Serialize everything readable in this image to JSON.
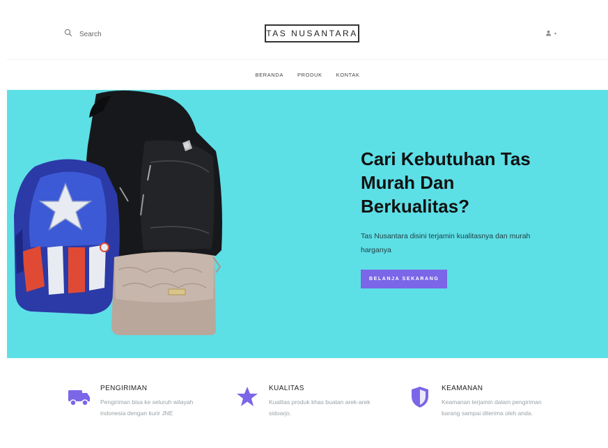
{
  "header": {
    "search": {
      "placeholder": "Search"
    },
    "brand": "TAS NUSANTARA",
    "user_menu": {
      "icon": "user-icon"
    }
  },
  "nav": {
    "items": [
      {
        "label": "BERANDA"
      },
      {
        "label": "PRODUK"
      },
      {
        "label": "KONTAK"
      }
    ]
  },
  "hero": {
    "bg_color": "#5ddfe6",
    "title_line1": "Cari Kebutuhan Tas",
    "title_line2": "Murah Dan",
    "title_line3": "Berkualitas?",
    "subtitle": "Tas Nusantara disini terjamin kualitasnya dan murah harganya",
    "cta_label": "BELANJA SEKARANG",
    "cta_color": "#7b66e8"
  },
  "features": [
    {
      "icon": "truck-icon",
      "title": "PENGIRIMAN",
      "text": "Pengiriman bisa ke seluruh wilayah indonesia dengan kurir JNE"
    },
    {
      "icon": "star-icon",
      "title": "KUALITAS",
      "text": "Kualitas produk khas buatan arek-arek sidoarjo."
    },
    {
      "icon": "shield-icon",
      "title": "KEAMANAN",
      "text": "Keamanan terjamin dalam pengiriman barang sampai diterima oleh anda."
    }
  ],
  "accent_color": "#7b66e8"
}
